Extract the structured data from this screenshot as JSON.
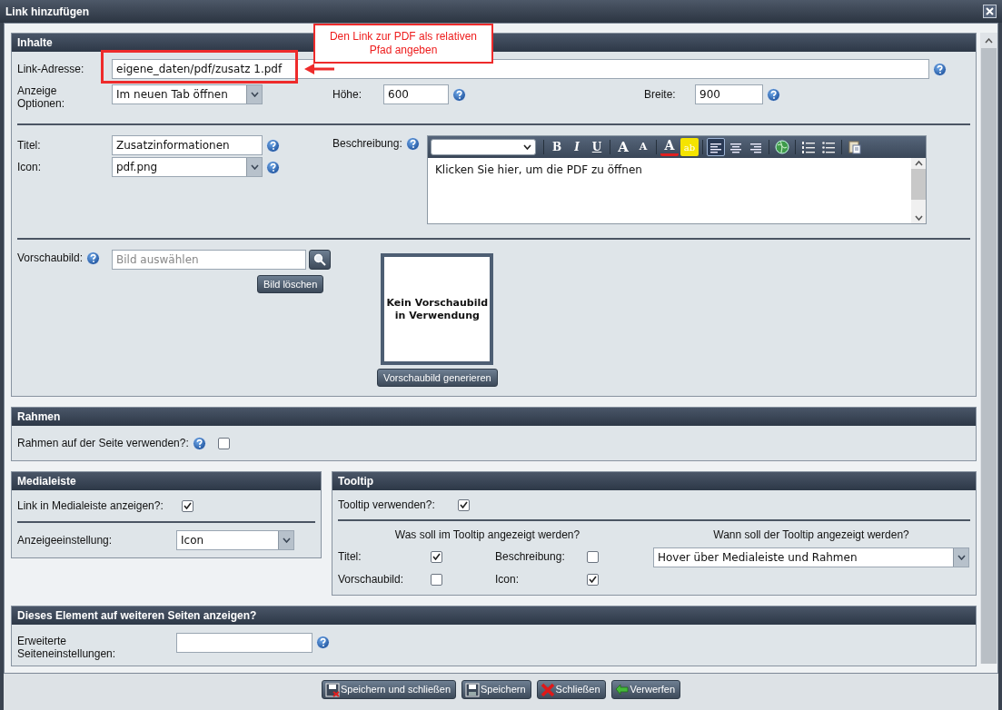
{
  "window": {
    "title": "Link hinzufügen"
  },
  "annotation": {
    "text": "Den Link zur PDF als relativen Pfad angeben"
  },
  "inhalte": {
    "title": "Inhalte",
    "link_address": {
      "label": "Link-Adresse:",
      "value": "eigene_daten/pdf/zusatz 1.pdf",
      "highlighted": true
    },
    "display_options": {
      "label": "Anzeige Optionen:",
      "value": "Im neuen Tab öffnen"
    },
    "height": {
      "label": "Höhe:",
      "value": "600"
    },
    "width": {
      "label": "Breite:",
      "value": "900"
    },
    "title_field": {
      "label": "Titel:",
      "value": "Zusatzinformationen"
    },
    "icon_field": {
      "label": "Icon:",
      "value": "pdf.png"
    },
    "description": {
      "label": "Beschreibung:",
      "text": "Klicken Sie hier, um die PDF zu öffnen",
      "toolbar": [
        {
          "kind": "bold",
          "label": "B"
        },
        {
          "kind": "italic",
          "label": "I"
        },
        {
          "kind": "underline",
          "label": "U"
        },
        {
          "kind": "grow",
          "label": "A"
        },
        {
          "kind": "shrink",
          "label": "A"
        },
        {
          "kind": "font_color",
          "label": "A"
        },
        {
          "kind": "highlight",
          "label": "ab"
        },
        {
          "kind": "align_left",
          "selected": true
        },
        {
          "kind": "align_center",
          "selected": false
        },
        {
          "kind": "align_right",
          "selected": false
        },
        {
          "kind": "link"
        },
        {
          "kind": "ordered_list"
        },
        {
          "kind": "bullet_list"
        },
        {
          "kind": "paste"
        }
      ]
    },
    "preview": {
      "label": "Vorschaubild:",
      "placeholder": "Bild auswählen",
      "delete_button": "Bild löschen",
      "empty_text": "Kein Vorschaubild in Verwendung",
      "generate_button": "Vorschaubild generieren"
    }
  },
  "rahmen": {
    "title": "Rahmen",
    "label": "Rahmen auf der Seite verwenden?:",
    "checked": false
  },
  "medialeiste": {
    "title": "Medialeiste",
    "link_label": "Link in Medialeiste anzeigen?:",
    "link_checked": true,
    "setting_label": "Anzeigeeinstellung:",
    "setting_value": "Icon"
  },
  "tooltip": {
    "title": "Tooltip",
    "use_label": "Tooltip verwenden?:",
    "use_checked": true,
    "what_heading": "Was soll im Tooltip angezeigt werden?",
    "what_items": [
      {
        "label": "Titel:",
        "checked": true
      },
      {
        "label": "Beschreibung:",
        "checked": false
      },
      {
        "label": "Vorschaubild:",
        "checked": false
      },
      {
        "label": "Icon:",
        "checked": true
      }
    ],
    "when_heading": "Wann soll der Tooltip angezeigt werden?",
    "when_value": "Hover über Medialeiste und Rahmen"
  },
  "other_pages": {
    "title": "Dieses Element auf weiteren Seiten anzeigen?",
    "label": "Erweiterte Seiteneinstellungen:"
  },
  "footer_buttons": [
    {
      "label": "Speichern und schließen",
      "kind": "save_close"
    },
    {
      "label": "Speichern",
      "kind": "save"
    },
    {
      "label": "Schließen",
      "kind": "close"
    },
    {
      "label": "Verwerfen",
      "kind": "undo"
    }
  ]
}
